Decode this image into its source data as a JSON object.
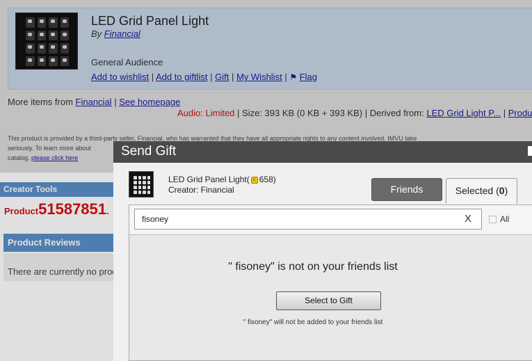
{
  "product": {
    "title": "LED Grid Panel Light",
    "by_prefix": "By",
    "creator": "Financial",
    "audience": "General Audience",
    "links": {
      "wishlist": "Add to wishlist",
      "giftlist": "Add to giftlist",
      "gift": "Gift",
      "my_wishlist": "My Wishlist",
      "flag": "Flag",
      "sep": "|"
    },
    "more_items_prefix": "More items from",
    "more_items_creator": "Financial",
    "see_homepage": "See homepage",
    "audio_label": "Audio:",
    "audio_value": "Limited",
    "size_text": "| Size: 393 KB (0 KB + 393 KB) | Derived from:",
    "derived_from": "LED Grid Light P...",
    "produ_link": "Produ",
    "disclaimer_line1": "This product is provided by a third-party seller, Financial, who has warranted that they have all appropriate rights to any content involved. IMVU take",
    "disclaimer_line2": "seriously. To learn more about",
    "disclaimer_line3_prefix": "catalog,",
    "disclaimer_link": "please click here"
  },
  "sidebar": {
    "creator_tools": "Creator Tools",
    "product_prefix": "Product",
    "product_id": "51587851",
    "product_suffix": ".",
    "reviews_title": "Product Reviews",
    "reviews_empty": "There are currently no products"
  },
  "modal": {
    "title": "Send Gift",
    "gift_name": "LED Grid Panel Light(",
    "gift_credits": "658)",
    "gift_creator": "Creator: Financial",
    "tabs": {
      "friends": "Friends",
      "selected_label": "Selected (",
      "selected_count": "0",
      "selected_close": ")"
    },
    "search": {
      "value": "fisoney",
      "clear": "X",
      "all_label": "All"
    },
    "not_friend_message": "\" fisoney\" is not on your friends list",
    "select_button": "Select to Gift",
    "note": "\" fisoney\" will not be added to your friends list"
  }
}
